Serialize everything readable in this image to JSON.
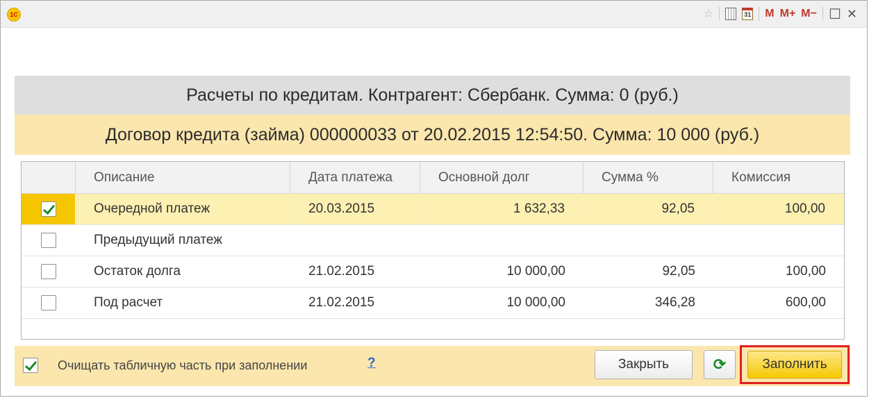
{
  "titlebar": {
    "logo": "1С",
    "calendar_day": "31",
    "m_label": "M",
    "mplus_label": "M+",
    "mminus_label": "M−",
    "maximize_glyph": "☐",
    "close_glyph": "✕",
    "icons": [
      "star-icon",
      "calculator-icon",
      "calendar-icon",
      "maximize-icon",
      "close-icon"
    ]
  },
  "header": {
    "line1": "Расчеты по кредитам. Контрагент: Сбербанк. Сумма: 0 (руб.)",
    "line2": "Договор кредита (займа) 000000033 от 20.02.2015 12:54:50. Сумма: 10 000 (руб.)"
  },
  "table": {
    "columns": [
      "Описание",
      "Дата платежа",
      "Основной долг",
      "Сумма %",
      "Комиссия"
    ],
    "rows": [
      {
        "checked": true,
        "description": "Очередной платеж",
        "date": "20.03.2015",
        "principal": "1 632,33",
        "interest": "92,05",
        "commission": "100,00"
      },
      {
        "checked": false,
        "description": "Предыдущий платеж",
        "date": "",
        "principal": "",
        "interest": "",
        "commission": ""
      },
      {
        "checked": false,
        "description": "Остаток долга",
        "date": "21.02.2015",
        "principal": "10 000,00",
        "interest": "92,05",
        "commission": "100,00"
      },
      {
        "checked": false,
        "description": "Под расчет",
        "date": "21.02.2015",
        "principal": "10 000,00",
        "interest": "346,28",
        "commission": "600,00"
      }
    ]
  },
  "footer": {
    "clear_checked": true,
    "clear_label": "Очищать табличную часть при заполнении",
    "help_label": "?",
    "close_button": "Закрыть",
    "refresh_glyph": "⟳",
    "fill_button": "Заполнить"
  },
  "colors": {
    "selected_row": "#fcf0b2",
    "header_yellow": "#fbe6ad",
    "highlight_frame": "#e02020"
  }
}
